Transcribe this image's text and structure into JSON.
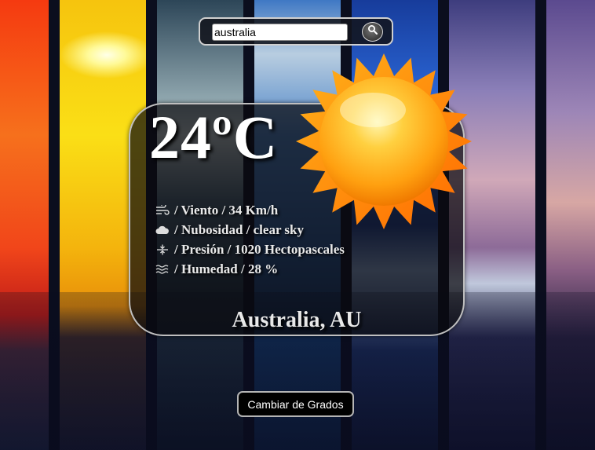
{
  "search": {
    "value": "australia",
    "button_icon": "search-icon"
  },
  "weather": {
    "temperature": "24ºC",
    "condition_icon": "sun-icon",
    "details": [
      {
        "icon": "wind-icon",
        "text": " / Viento / 34 Km/h"
      },
      {
        "icon": "cloud-icon",
        "text": " / Nubosidad / clear sky"
      },
      {
        "icon": "pressure-icon",
        "text": " / Presión / 1020 Hectopascales"
      },
      {
        "icon": "humidity-icon",
        "text": " / Humedad / 28 %"
      }
    ],
    "location": "Australia, AU"
  },
  "controls": {
    "toggle_units_label": "Cambiar de Grados"
  },
  "colors": {
    "sun_core": "#ffb020",
    "sun_rays": "#ff7a0a",
    "card_border": "#bfbfbf"
  }
}
